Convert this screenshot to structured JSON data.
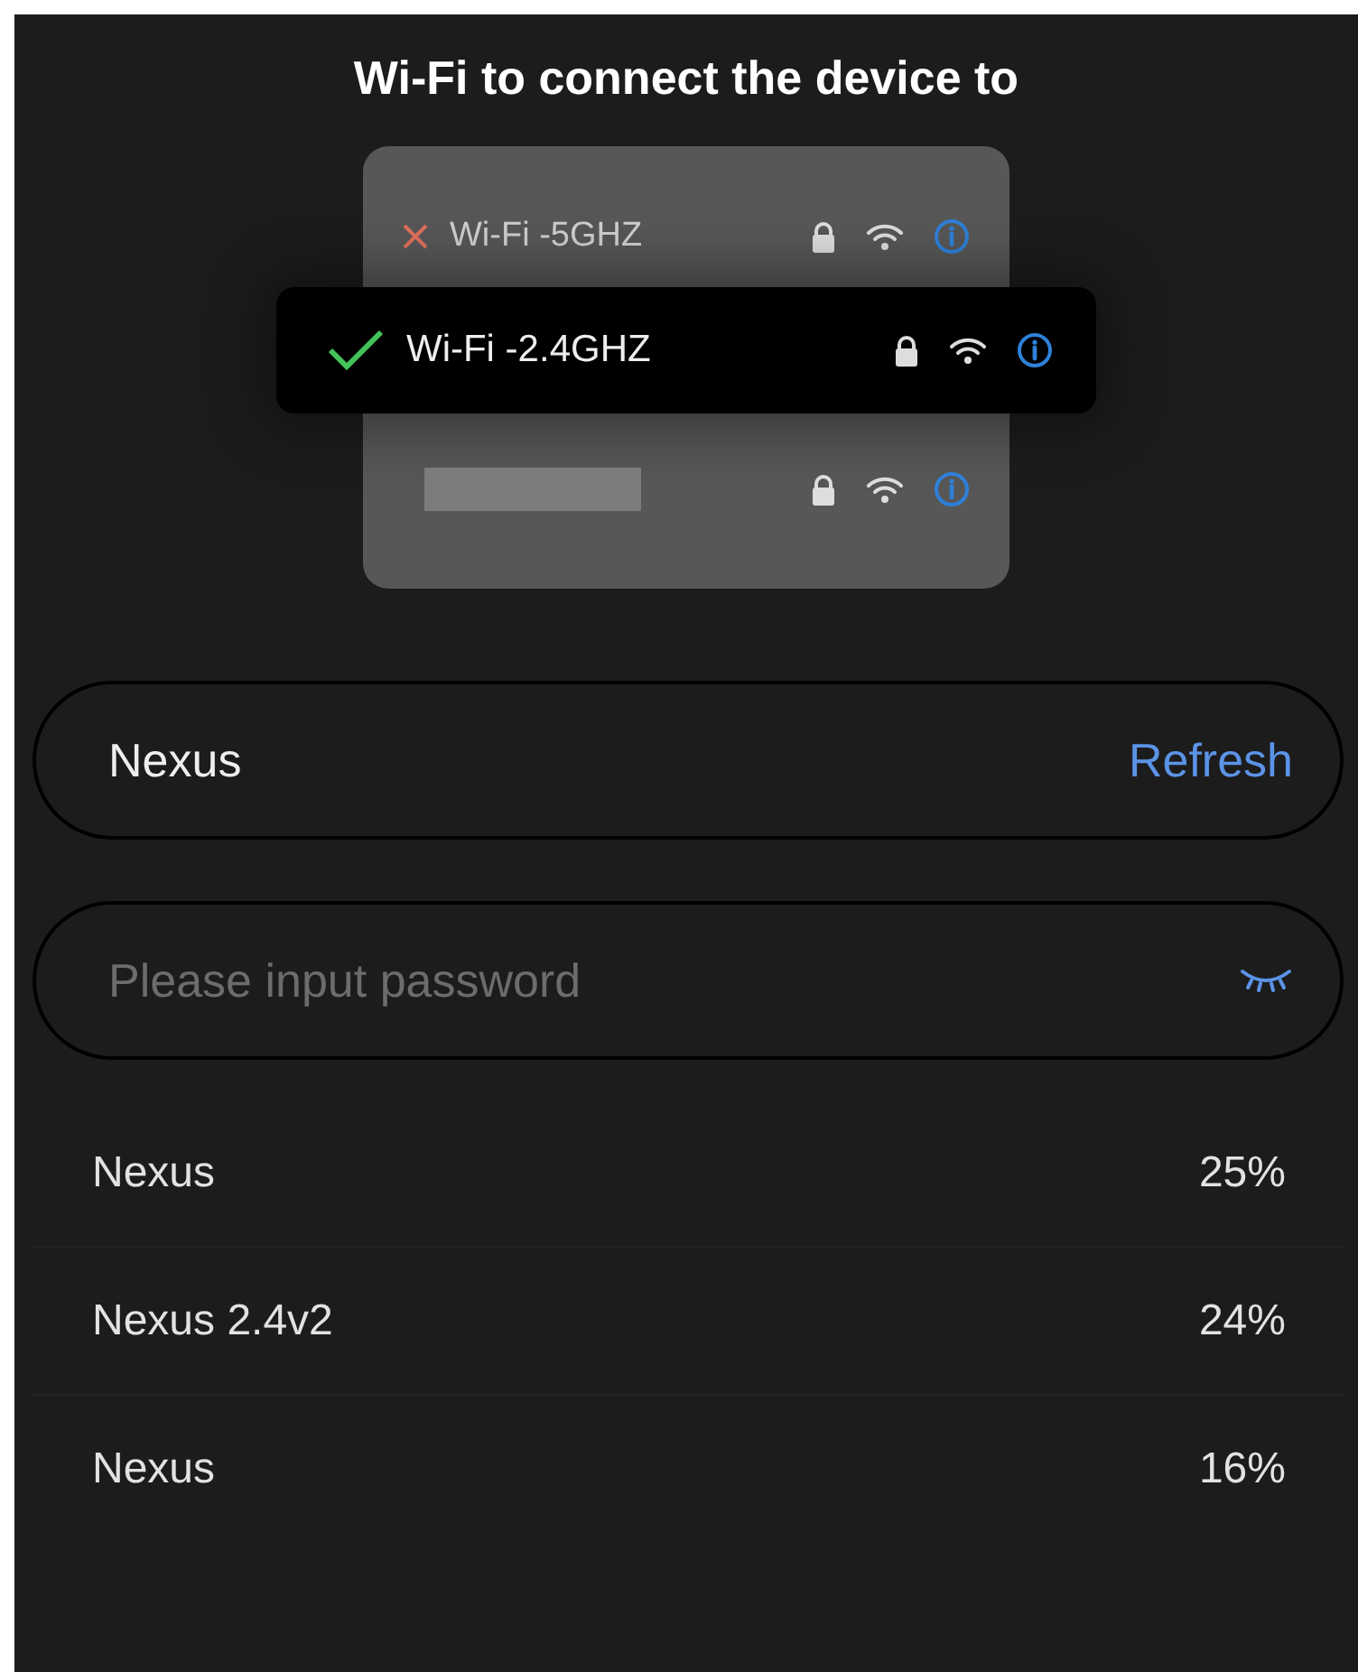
{
  "title": "Wi-Fi to connect the device to",
  "illustration": {
    "networks": [
      {
        "kind": "named",
        "name": "Wi-Fi -5GHZ",
        "connected": false,
        "selected": false
      },
      {
        "kind": "named",
        "name": "Wi-Fi -2.4GHZ",
        "connected": true,
        "selected": true
      },
      {
        "kind": "masked",
        "selected": false
      }
    ]
  },
  "network_field": {
    "value": "Nexus",
    "action": "Refresh"
  },
  "password_field": {
    "placeholder": "Please input password",
    "visible": false
  },
  "networks": [
    {
      "name": "Nexus",
      "signal": "25%"
    },
    {
      "name": "Nexus 2.4v2",
      "signal": "24%"
    },
    {
      "name": "Nexus",
      "signal": "16%"
    }
  ]
}
